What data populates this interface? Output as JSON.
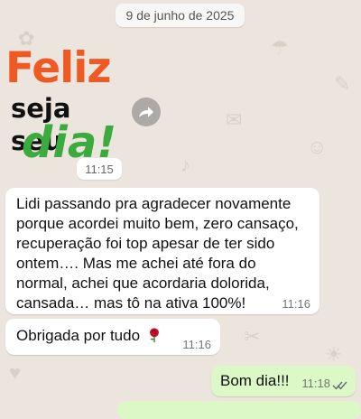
{
  "date_chip": "9 de junho de 2025",
  "sticker": {
    "line1": "Feliz",
    "line2": "seja seu",
    "line3": "dia!",
    "time": "11:15",
    "forward_icon": "forward-icon"
  },
  "messages": [
    {
      "text": "Lidi passando pra agradecer novamente porque acordei muito bem, zero cansaço, recuperação foi top apesar de ter sido ontem…. Mas me achei até fora do normal, achei que acordaria dolorida, cansada… mas tô na ativa 100%!",
      "time": "11:16",
      "direction": "incoming"
    },
    {
      "text": "Obrigada por tudo",
      "emoji": "rose-icon",
      "time": "11:16",
      "direction": "incoming"
    },
    {
      "text": "Bom dia!!!",
      "time": "11:18",
      "status": "read-double-check-icon",
      "direction": "outgoing"
    }
  ],
  "colors": {
    "wallpaper": "#ece5dd",
    "incoming_bubble": "#ffffff",
    "outgoing_bubble": "#dcf8c6",
    "sticker_orange": "#ef5a24",
    "sticker_green": "#3cab3f"
  }
}
